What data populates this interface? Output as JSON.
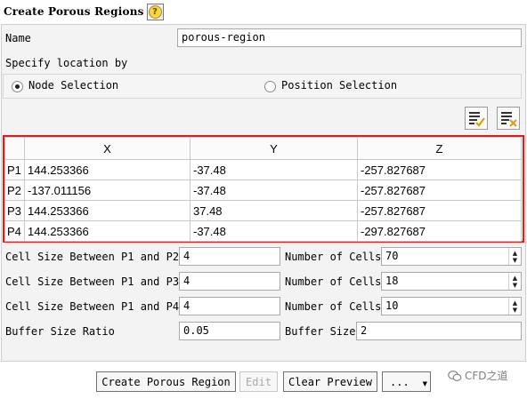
{
  "dialog": {
    "title": "Create Porous Regions",
    "help_icon": "question-icon"
  },
  "name": {
    "label": "Name",
    "value": "porous-region"
  },
  "location": {
    "label": "Specify location by",
    "options": [
      {
        "label": "Node Selection",
        "selected": true
      },
      {
        "label": "Position Selection",
        "selected": false
      }
    ]
  },
  "toolbar": {
    "icons": [
      "select-all-icon",
      "clear-selection-icon"
    ]
  },
  "table": {
    "headers": [
      "",
      "X",
      "Y",
      "Z"
    ],
    "rows": [
      {
        "id": "P1",
        "x": "144.253366",
        "y": "-37.48",
        "z": "-257.827687"
      },
      {
        "id": "P2",
        "x": "-137.011156",
        "y": "-37.48",
        "z": "-257.827687"
      },
      {
        "id": "P3",
        "x": "144.253366",
        "y": "37.48",
        "z": "-257.827687"
      },
      {
        "id": "P4",
        "x": "144.253366",
        "y": "-37.48",
        "z": "-297.827687"
      }
    ]
  },
  "cell_sizes": [
    {
      "label": "Cell Size Between P1 and P2",
      "value": "4",
      "count_label": "Number of Cells",
      "count": "70"
    },
    {
      "label": "Cell Size Between P1 and P3",
      "value": "4",
      "count_label": "Number of Cells",
      "count": "18"
    },
    {
      "label": "Cell Size Between P1 and P4",
      "value": "4",
      "count_label": "Number of Cells",
      "count": "10"
    }
  ],
  "buffer": {
    "ratio_label": "Buffer Size Ratio",
    "ratio": "0.05",
    "size_label": "Buffer Size",
    "size": "2"
  },
  "buttons": {
    "create": "Create Porous Region",
    "edit": "Edit",
    "clear_preview": "Clear Preview",
    "more": "..."
  },
  "watermark": "CFD之道"
}
